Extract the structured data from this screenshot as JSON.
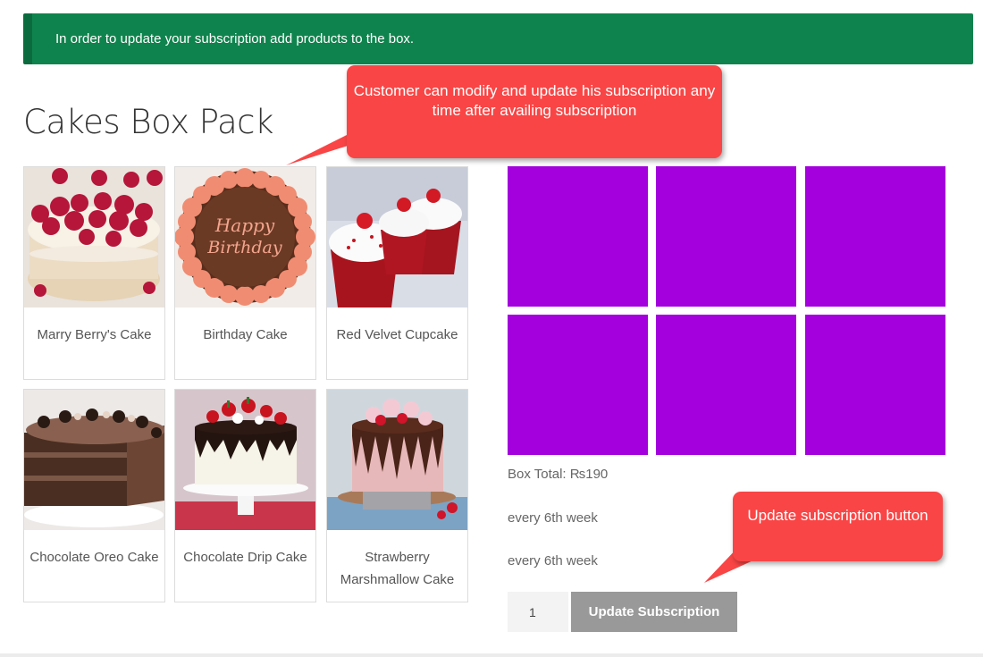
{
  "notice": {
    "text": "In order to update your subscription add products to the box."
  },
  "title": "Cakes Box Pack",
  "products": [
    {
      "name": "Marry Berry's Cake",
      "image_icon": "raspberry-meringue-cake-icon"
    },
    {
      "name": "Birthday Cake",
      "image_icon": "birthday-cake-icon",
      "image_text": "Happy Birthday"
    },
    {
      "name": "Red Velvet Cupcake",
      "image_icon": "red-velvet-cupcake-icon"
    },
    {
      "name": "Chocolate Oreo Cake",
      "image_icon": "chocolate-oreo-cake-icon"
    },
    {
      "name": "Chocolate Drip Cake",
      "image_icon": "chocolate-drip-cake-icon"
    },
    {
      "name": "Strawberry Marshmallow Cake",
      "image_icon": "strawberry-marshmallow-cake-icon"
    }
  ],
  "box": {
    "slot_count": 6,
    "slot_color": "#a300dd",
    "total_label": "Box Total: ",
    "total_value": "₨190",
    "frequency_1": "every 6th week",
    "frequency_2": "every 6th week"
  },
  "form": {
    "quantity": "1",
    "update_label": "Update Subscription"
  },
  "callouts": {
    "top": "Customer can modify and update his subscription any time after availing subscription",
    "button": "Update subscription button"
  },
  "colors": {
    "notice_bg": "#0f834d",
    "callout_bg": "#f94545",
    "button_bg": "#999999"
  }
}
